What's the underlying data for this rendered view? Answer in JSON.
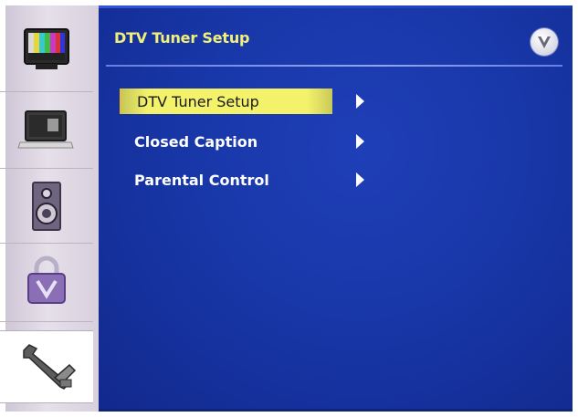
{
  "panel": {
    "title": "DTV Tuner Setup"
  },
  "menu": {
    "items": [
      {
        "label": "DTV Tuner Setup",
        "selected": true
      },
      {
        "label": "Closed Caption",
        "selected": false
      },
      {
        "label": "Parental Control",
        "selected": false
      }
    ]
  },
  "sidebar": {
    "items": [
      {
        "icon": "tv-color-bars-icon"
      },
      {
        "icon": "laptop-icon"
      },
      {
        "icon": "speaker-icon"
      },
      {
        "icon": "padlock-icon"
      },
      {
        "icon": "wrench-icon",
        "active": true
      }
    ]
  },
  "colors": {
    "panel_bg": "#1837a8",
    "title": "#f3f07a",
    "highlight": "#f3f26a",
    "menu_text": "#ffffff"
  }
}
